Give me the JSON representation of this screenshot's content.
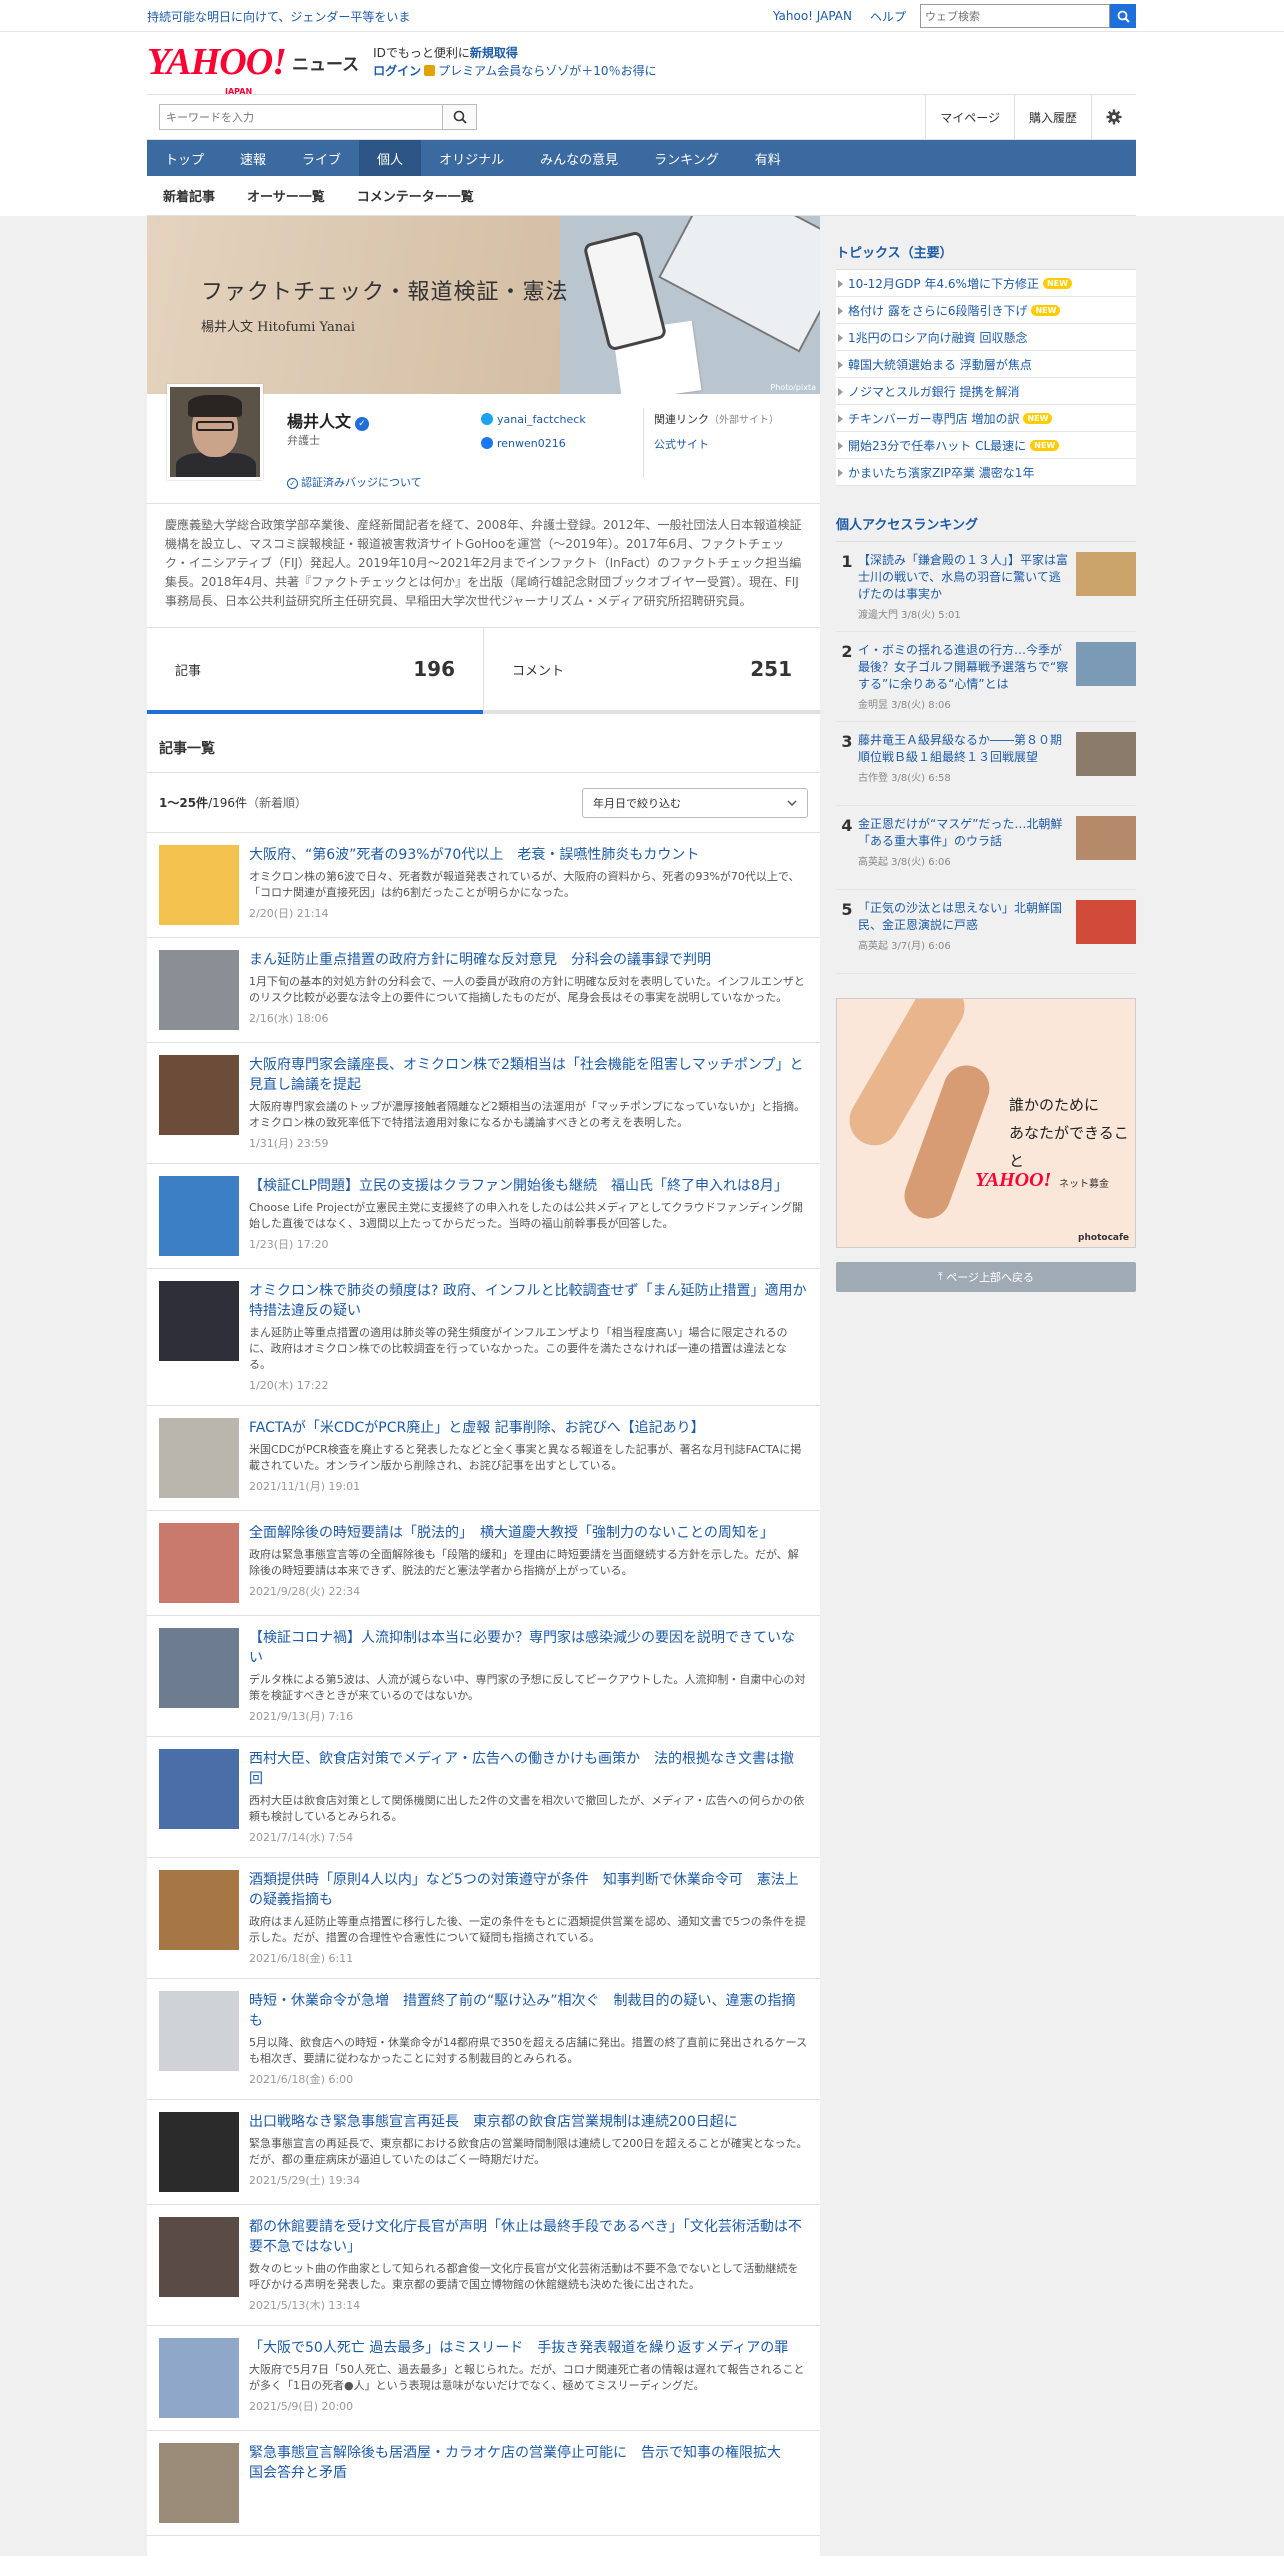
{
  "topbar": {
    "promo": "持続可能な明日に向けて、ジェンダー平等をいま",
    "links": [
      "Yahoo! JAPAN",
      "ヘルプ"
    ],
    "search_placeholder": "ウェブ検索"
  },
  "header": {
    "logo": "YAHOO!",
    "logo_sub": "JAPAN",
    "service": "ニュース",
    "line1_prefix": "IDでもっと便利に",
    "line1_link": "新規取得",
    "login": "ログイン",
    "premium": "プレミアム会員ならゾゾが＋10％お得に"
  },
  "searchrow": {
    "placeholder": "キーワードを入力",
    "mypage": "マイページ",
    "history": "購入履歴"
  },
  "gnav": [
    "トップ",
    "速報",
    "ライブ",
    "個人",
    "オリジナル",
    "みんなの意見",
    "ランキング",
    "有料"
  ],
  "gnav_active": "個人",
  "subnav": [
    "新着記事",
    "オーサー一覧",
    "コメンテーター一覧"
  ],
  "banner": {
    "title": "ファクトチェック・報道検証・憲法",
    "subtitle": "楊井人文  Hitofumi Yanai",
    "credit": "Photo/pixta"
  },
  "profile": {
    "name": "楊井人文",
    "title": "弁護士",
    "badge_link": "認証済みバッジについて",
    "twitter": "yanai_factcheck",
    "facebook": "renwen0216",
    "related_label": "関連リンク",
    "related_sub": "（外部サイト）",
    "official": "公式サイト",
    "bio": "慶應義塾大学総合政策学部卒業後、産経新聞記者を経て、2008年、弁護士登録。2012年、一般社団法人日本報道検証機構を設立し、マスコミ誤報検証・報道被害救済サイトGoHooを運営（〜2019年）。2017年6月、ファクトチェック・イニシアティブ（FIJ）発起人。2019年10月〜2021年2月までインファクト（InFact）のファクトチェック担当編集長。2018年4月、共著『ファクトチェックとは何か』を出版（尾崎行雄記念財団ブックオブイヤー受賞）。現在、FIJ事務局長、日本公共利益研究所主任研究員、早稲田大学次世代ジャーナリズム・メディア研究所招聘研究員。"
  },
  "tabs": [
    {
      "label": "記事",
      "count": "196"
    },
    {
      "label": "コメント",
      "count": "251"
    }
  ],
  "list": {
    "heading": "記事一覧",
    "range": "1〜25件",
    "total": "/196件",
    "order": "（新着順）",
    "filter": "年月日で絞り込む"
  },
  "articles": [
    {
      "title": "大阪府、“第6波”死者の93%が70代以上　老衰・誤嚥性肺炎もカウント",
      "desc": "オミクロン株の第6波で日々、死者数が報道発表されているが、大阪府の資料から、死者の93%が70代以上で、「コロナ関連が直接死因」は約6割だったことが明らかになった。",
      "date": "2/20(日) 21:14"
    },
    {
      "title": "まん延防止重点措置の政府方針に明確な反対意見　分科会の議事録で判明",
      "desc": "1月下旬の基本的対処方針の分科会で、一人の委員が政府の方針に明確な反対を表明していた。インフルエンザとのリスク比較が必要な法令上の要件について指摘したものだが、尾身会長はその事実を説明していなかった。",
      "date": "2/16(水) 18:06"
    },
    {
      "title": "大阪府専門家会議座長、オミクロン株で2類相当は「社会機能を阻害しマッチポンプ」と見直し論議を提起",
      "desc": "大阪府専門家会議のトップが濃厚接触者隔離など2類相当の法運用が「マッチポンプになっていないか」と指摘。オミクロン株の致死率低下で特措法適用対象になるかも議論すべきとの考えを表明した。",
      "date": "1/31(月) 23:59"
    },
    {
      "title": "【検証CLP問題】立民の支援はクラファン開始後も継続　福山氏「終了申入れは8月」",
      "desc": "Choose Life Projectが立憲民主党に支援終了の申入れをしたのは公共メディアとしてクラウドファンディング開始した直後ではなく、3週間以上たってからだった。当時の福山前幹事長が回答した。",
      "date": "1/23(日) 17:20"
    },
    {
      "title": "オミクロン株で肺炎の頻度は? 政府、インフルと比較調査せず「まん延防止措置」適用か　特措法違反の疑い",
      "desc": "まん延防止等重点措置の適用は肺炎等の発生頻度がインフルエンザより「相当程度高い」場合に限定されるのに、政府はオミクロン株での比較調査を行っていなかった。この要件を満たさなければ一連の措置は違法となる。",
      "date": "1/20(木) 17:22"
    },
    {
      "title": "FACTAが「米CDCがPCR廃止」と虚報 記事削除、お詫びへ【追記あり】",
      "desc": "米国CDCがPCR検査を廃止すると発表したなどと全く事実と異なる報道をした記事が、著名な月刊誌FACTAに掲載されていた。オンライン版から削除され、お詫び記事を出すとしている。",
      "date": "2021/11/1(月) 19:01"
    },
    {
      "title": "全面解除後の時短要請は「脱法的」　横大道慶大教授「強制力のないことの周知を」",
      "desc": "政府は緊急事態宣言等の全面解除後も「段階的緩和」を理由に時短要請を当面継続する方針を示した。だが、解除後の時短要請は本来できず、脱法的だと憲法学者から指摘が上がっている。",
      "date": "2021/9/28(火) 22:34"
    },
    {
      "title": "【検証コロナ禍】人流抑制は本当に必要か？専門家は感染減少の要因を説明できていない",
      "desc": "デルタ株による第5波は、人流が減らない中、専門家の予想に反してピークアウトした。人流抑制・自粛中心の対策を検証すべきときが来ているのではないか。",
      "date": "2021/9/13(月) 7:16"
    },
    {
      "title": "西村大臣、飲食店対策でメディア・広告への働きかけも画策か　法的根拠なき文書は撤回",
      "desc": "西村大臣は飲食店対策として関係機関に出した2件の文書を相次いで撤回したが、メディア・広告への何らかの依頼も検討しているとみられる。",
      "date": "2021/7/14(水) 7:54"
    },
    {
      "title": "酒類提供時「原則4人以内」など5つの対策遵守が条件　知事判断で休業命令可　憲法上の疑義指摘も",
      "desc": "政府はまん延防止等重点措置に移行した後、一定の条件をもとに酒類提供営業を認め、通知文書で5つの条件を提示した。だが、措置の合理性や合憲性について疑問も指摘されている。",
      "date": "2021/6/18(金) 6:11"
    },
    {
      "title": "時短・休業命令が急増　措置終了前の“駆け込み”相次ぐ　制裁目的の疑い、違憲の指摘も",
      "desc": "5月以降、飲食店への時短・休業命令が14都府県で350を超える店舗に発出。措置の終了直前に発出されるケースも相次ぎ、要請に従わなかったことに対する制裁目的とみられる。",
      "date": "2021/6/18(金) 6:00"
    },
    {
      "title": "出口戦略なき緊急事態宣言再延長　東京都の飲食店営業規制は連続200日超に",
      "desc": "緊急事態宣言の再延長で、東京都における飲食店の営業時間制限は連続して200日を超えることが確実となった。だが、都の重症病床が逼迫していたのはごく一時期だけだ。",
      "date": "2021/5/29(土) 19:34"
    },
    {
      "title": "都の休館要請を受け文化庁長官が声明「休止は最終手段であるべき」「文化芸術活動は不要不急ではない」",
      "desc": "数々のヒット曲の作曲家として知られる都倉俊一文化庁長官が文化芸術活動は不要不急でないとして活動継続を呼びかける声明を発表した。東京都の要請で国立博物館の休館継続も決めた後に出された。",
      "date": "2021/5/13(木) 13:14"
    },
    {
      "title": "「大阪で50人死亡 過去最多」はミスリード　手抜き発表報道を繰り返すメディアの罪",
      "desc": "大阪府で5月7日「50人死亡、過去最多」と報じられた。だが、コロナ関連死亡者の情報は遅れて報告されることが多く「1日の死者●人」という表現は意味がないだけでなく、極めてミスリーディングだ。",
      "date": "2021/5/9(日) 20:00"
    },
    {
      "title": "緊急事態宣言解除後も居酒屋・カラオケ店の営業停止可能に　告示で知事の権限拡大　国会答弁と矛盾",
      "desc": "",
      "date": ""
    }
  ],
  "sidebar": {
    "topics_title": "トピックス（主要）",
    "topics": [
      {
        "text": "10-12月GDP 年4.6%増に下方修正",
        "new": true
      },
      {
        "text": "格付け 露をさらに6段階引き下げ",
        "new": true
      },
      {
        "text": "1兆円のロシア向け融資 回収懸念",
        "new": false
      },
      {
        "text": "韓国大統領選始まる 浮動層が焦点",
        "new": false
      },
      {
        "text": "ノジマとスルガ銀行 提携を解消",
        "new": false
      },
      {
        "text": "チキンバーガー専門店 増加の訳",
        "new": true
      },
      {
        "text": "開始23分で任奉ハット CL最速に",
        "new": true
      },
      {
        "text": "かまいたち濱家ZIP卒業 濃密な1年",
        "new": false
      }
    ],
    "new_label": "NEW",
    "ranking_title": "個人アクセスランキング",
    "ranking": [
      {
        "n": "1",
        "title": "【深読み「鎌倉殿の１３人」】平家は富士川の戦いで、水鳥の羽音に驚いて逃げたのは事実か",
        "meta": "渡邊大門 3/8(火) 5:01"
      },
      {
        "n": "2",
        "title": "イ・ボミの揺れる進退の行方…今季が最後？女子ゴルフ開幕戦予選落ちで“察する”に余りある“心情”とは",
        "meta": "金明昱 3/8(火) 8:06"
      },
      {
        "n": "3",
        "title": "藤井竜王Ａ級昇級なるか――第８０期順位戦Ｂ級１組最終１３回戦展望",
        "meta": "古作登 3/8(火) 6:58"
      },
      {
        "n": "4",
        "title": "金正恩だけが“マスゲ”だった…北朝鮮「ある重大事件」のウラ話",
        "meta": "高英起 3/8(火) 6:06"
      },
      {
        "n": "5",
        "title": "「正気の沙汰とは思えない」北朝鮮国民、金正恩演説に戸惑",
        "meta": "高英起 3/7(月) 6:06"
      }
    ],
    "ad_line1": "誰かのために",
    "ad_line2": "あなたができること",
    "ad_brand": "YAHOO!",
    "ad_brand_sub": "ネット募金",
    "ad_credit": "photocafe",
    "totop": "ページ上部へ戻る"
  }
}
